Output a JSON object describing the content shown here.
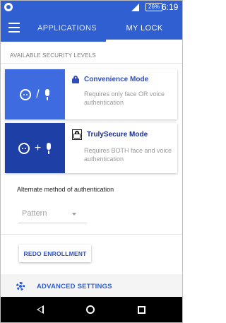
{
  "status_bar": {
    "battery": "26%",
    "time": "6:19"
  },
  "tabs": [
    {
      "label": "APPLICATIONS",
      "selected": false
    },
    {
      "label": "MY LOCK",
      "selected": true
    }
  ],
  "security": {
    "section_label": "AVAILABLE SECURITY LEVELS",
    "levels": [
      {
        "title": "Convenience Mode",
        "description": "Requires only face OR voice authentication",
        "operator": "/",
        "color": "#3f6be0",
        "icon": "lock-icon"
      },
      {
        "title": "TrulySecure Mode",
        "description": "Requires BOTH face and voice authentication",
        "operator": "+",
        "color": "#1d3fa6",
        "icon": "lock-outline-icon"
      }
    ]
  },
  "alternate": {
    "label": "Alternate method of authentication",
    "selected_value": "Pattern"
  },
  "redo_button": {
    "label": "REDO ENROLLMENT"
  },
  "advanced": {
    "label": "ADVANCED SETTINGS"
  },
  "colors": {
    "primary": "#2f5fd0",
    "accent_text": "#2f4db8"
  }
}
